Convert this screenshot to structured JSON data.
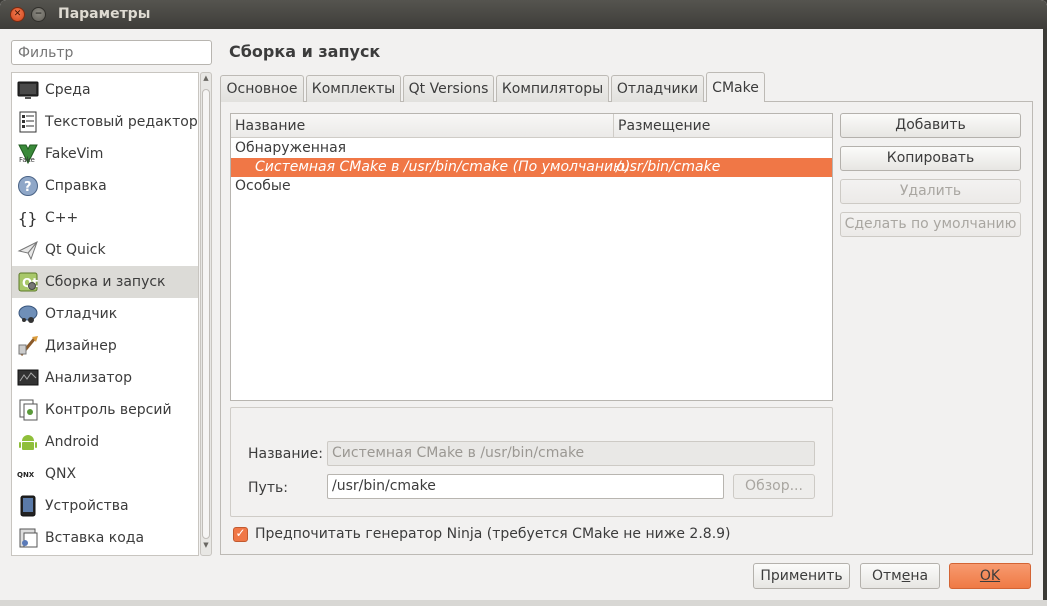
{
  "window": {
    "title": "Параметры"
  },
  "filter": {
    "placeholder": "Фильтр"
  },
  "sidebar": {
    "items": [
      {
        "label": "Среда",
        "icon": "monitor-icon"
      },
      {
        "label": "Текстовый редактор",
        "icon": "text-editor-icon"
      },
      {
        "label": "FakeVim",
        "icon": "fakevim-icon",
        "icon_text": "Fake"
      },
      {
        "label": "Справка",
        "icon": "help-icon"
      },
      {
        "label": "C++",
        "icon": "cpp-braces-icon"
      },
      {
        "label": "Qt Quick",
        "icon": "paper-plane-icon"
      },
      {
        "label": "Сборка и запуск",
        "icon": "build-run-icon",
        "selected": true
      },
      {
        "label": "Отладчик",
        "icon": "debugger-icon"
      },
      {
        "label": "Дизайнер",
        "icon": "designer-brush-icon"
      },
      {
        "label": "Анализатор",
        "icon": "analyzer-icon"
      },
      {
        "label": "Контроль версий",
        "icon": "version-control-icon"
      },
      {
        "label": "Android",
        "icon": "android-icon"
      },
      {
        "label": "QNX",
        "icon": "qnx-icon",
        "icon_text": "QNX"
      },
      {
        "label": "Устройства",
        "icon": "devices-icon"
      },
      {
        "label": "Вставка кода",
        "icon": "code-paste-icon"
      }
    ]
  },
  "page": {
    "title": "Сборка и запуск"
  },
  "tabs": [
    {
      "label": "Основное"
    },
    {
      "label": "Комплекты"
    },
    {
      "label": "Qt Versions"
    },
    {
      "label": "Компиляторы"
    },
    {
      "label": "Отладчики"
    },
    {
      "label": "CMake",
      "active": true
    }
  ],
  "table": {
    "columns": [
      "Название",
      "Размещение"
    ],
    "groups": [
      {
        "label": "Обнаруженная",
        "rows": [
          {
            "name": "Системная CMake в /usr/bin/cmake (По умолчанию)",
            "location": "/usr/bin/cmake",
            "selected": true
          }
        ]
      },
      {
        "label": "Особые",
        "rows": []
      }
    ]
  },
  "actions": {
    "add": "Добавить",
    "copy": "Копировать",
    "remove": "Удалить",
    "make_default": "Сделать по умолчанию"
  },
  "details": {
    "name_label": "Название:",
    "name_value": "Системная CMake в /usr/bin/cmake",
    "path_label": "Путь:",
    "path_value": "/usr/bin/cmake",
    "browse": "Обзор..."
  },
  "ninja": {
    "label": "Предпочитать генератор Ninja (требуется CMake не ниже 2.8.9)",
    "checked": true
  },
  "dialog": {
    "apply": "Применить",
    "cancel_a": "Отм",
    "cancel_b": "е",
    "cancel_c": "на",
    "ok": "OK"
  },
  "colors": {
    "accent": "#f07746",
    "titlebar": "#3c3b37"
  }
}
